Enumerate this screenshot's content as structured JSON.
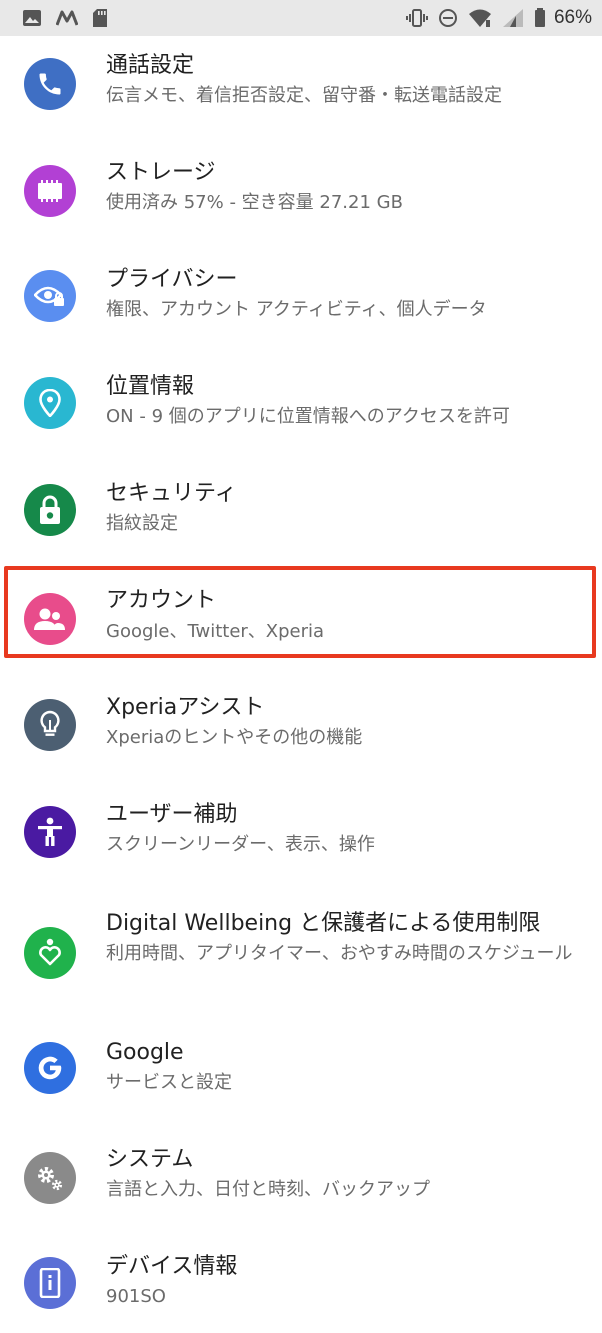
{
  "status_bar": {
    "battery": "66%",
    "icons": [
      "gallery-icon",
      "m-icon",
      "sdcard-icon",
      "vibrate-icon",
      "dnd-icon",
      "wifi-icon",
      "signal-icon",
      "battery-icon"
    ]
  },
  "settings": [
    {
      "title": "通話設定",
      "subtitle": "伝言メモ、着信拒否設定、留守番・転送電話設定",
      "icon": "phone-icon",
      "color": "#3f6fc4"
    },
    {
      "title": "ストレージ",
      "subtitle": "使用済み 57% - 空き容量 27.21 GB",
      "icon": "storage-icon",
      "color": "#b240d4"
    },
    {
      "title": "プライバシー",
      "subtitle": "権限、アカウント アクティビティ、個人データ",
      "icon": "privacy-icon",
      "color": "#5a8ef0"
    },
    {
      "title": "位置情報",
      "subtitle": "ON - 9 個のアプリに位置情報へのアクセスを許可",
      "icon": "location-icon",
      "color": "#29b7d1"
    },
    {
      "title": "セキュリティ",
      "subtitle": "指紋設定",
      "icon": "lock-icon",
      "color": "#16894a"
    },
    {
      "title": "アカウント",
      "subtitle": "Google、Twitter、Xperia",
      "icon": "account-icon",
      "color": "#e84c8b"
    },
    {
      "title": "Xperiaアシスト",
      "subtitle": "Xperiaのヒントやその他の機能",
      "icon": "lightbulb-icon",
      "color": "#4c5f72"
    },
    {
      "title": "ユーザー補助",
      "subtitle": "スクリーンリーダー、表示、操作",
      "icon": "accessibility-icon",
      "color": "#4a1aa2"
    },
    {
      "title": "Digital Wellbeing と保護者による使用制限",
      "subtitle": "利用時間、アプリタイマー、おやすみ時間のスケジュール",
      "icon": "wellbeing-icon",
      "color": "#20b24c"
    },
    {
      "title": "Google",
      "subtitle": "サービスと設定",
      "icon": "google-icon",
      "color": "#2f6fe0"
    },
    {
      "title": "システム",
      "subtitle": "言語と入力、日付と時刻、バックアップ",
      "icon": "gear-icon",
      "color": "#8a8a8a"
    },
    {
      "title": "デバイス情報",
      "subtitle": "901SO",
      "icon": "device-info-icon",
      "color": "#5b6fd6"
    }
  ]
}
